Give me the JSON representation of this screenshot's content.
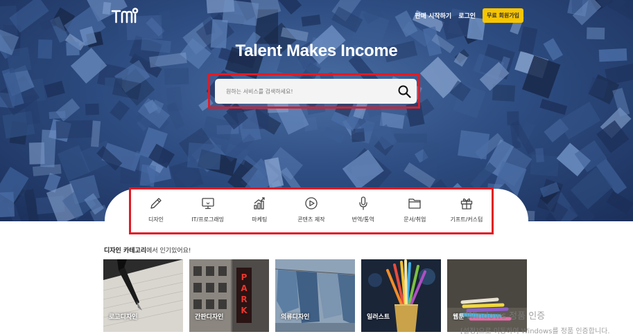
{
  "brand": {
    "logo_text": "TMi"
  },
  "nav": {
    "start_selling": "판매 시작하기",
    "login": "로그인",
    "signup": "무료 회원가입"
  },
  "hero": {
    "title": "Talent Makes Income"
  },
  "search": {
    "placeholder": "원하는 서비스를 검색하세요!"
  },
  "categories": [
    {
      "label": "디자인",
      "icon": "pencil-icon"
    },
    {
      "label": "IT/프로그래밍",
      "icon": "monitor-icon"
    },
    {
      "label": "마케팅",
      "icon": "chart-icon"
    },
    {
      "label": "콘텐츠 제작",
      "icon": "play-icon"
    },
    {
      "label": "번역/통역",
      "icon": "microphone-icon"
    },
    {
      "label": "문서/취업",
      "icon": "folder-icon"
    },
    {
      "label": "기프트/커스텀",
      "icon": "gift-icon"
    }
  ],
  "popular": {
    "heading_bold": "디자인 카테고리",
    "heading_rest": "에서 인기있어요!",
    "cards": [
      {
        "label": "로고디자인",
        "image": "fountain-pen-photo"
      },
      {
        "label": "간판디자인",
        "image": "park-sign-photo"
      },
      {
        "label": "의류디자인",
        "image": "clothes-line-photo"
      },
      {
        "label": "일러스트",
        "image": "colored-pencils-photo"
      },
      {
        "label": "웹툰",
        "image": "markers-photo"
      }
    ]
  },
  "watermark": {
    "line1": "Windows 정품 인증",
    "line2": "[설정]으로 이동하여 Windows를 정품 인증합니다."
  },
  "colors": {
    "accent_yellow": "#f7c500",
    "highlight_red": "#e01b24",
    "hero_blue": "#2e4d82"
  }
}
